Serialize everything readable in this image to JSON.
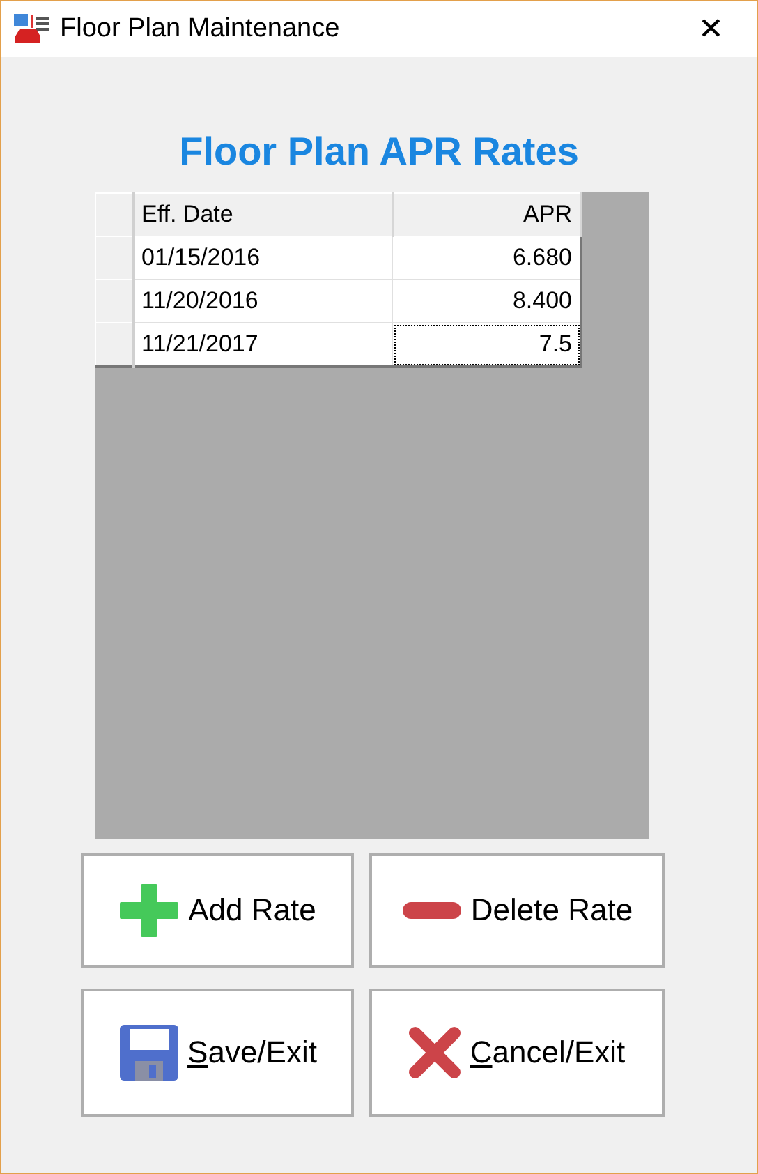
{
  "window": {
    "title": "Floor Plan Maintenance",
    "close": "✕"
  },
  "heading": "Floor Plan APR Rates",
  "table": {
    "columns": [
      "Eff. Date",
      "APR"
    ],
    "rows": [
      {
        "date": "01/15/2016",
        "apr": "6.680",
        "focused": false
      },
      {
        "date": "11/20/2016",
        "apr": "8.400",
        "focused": false
      },
      {
        "date": "11/21/2017",
        "apr": "7.5",
        "focused": true
      }
    ]
  },
  "buttons": [
    {
      "kind": "add",
      "label": "Add Rate",
      "underline_first": false
    },
    {
      "kind": "delete",
      "label": "Delete Rate",
      "underline_first": false
    },
    {
      "kind": "save",
      "label": "Save/Exit",
      "underline_first": true
    },
    {
      "kind": "cancel",
      "label": "Cancel/Exit",
      "underline_first": true
    }
  ]
}
